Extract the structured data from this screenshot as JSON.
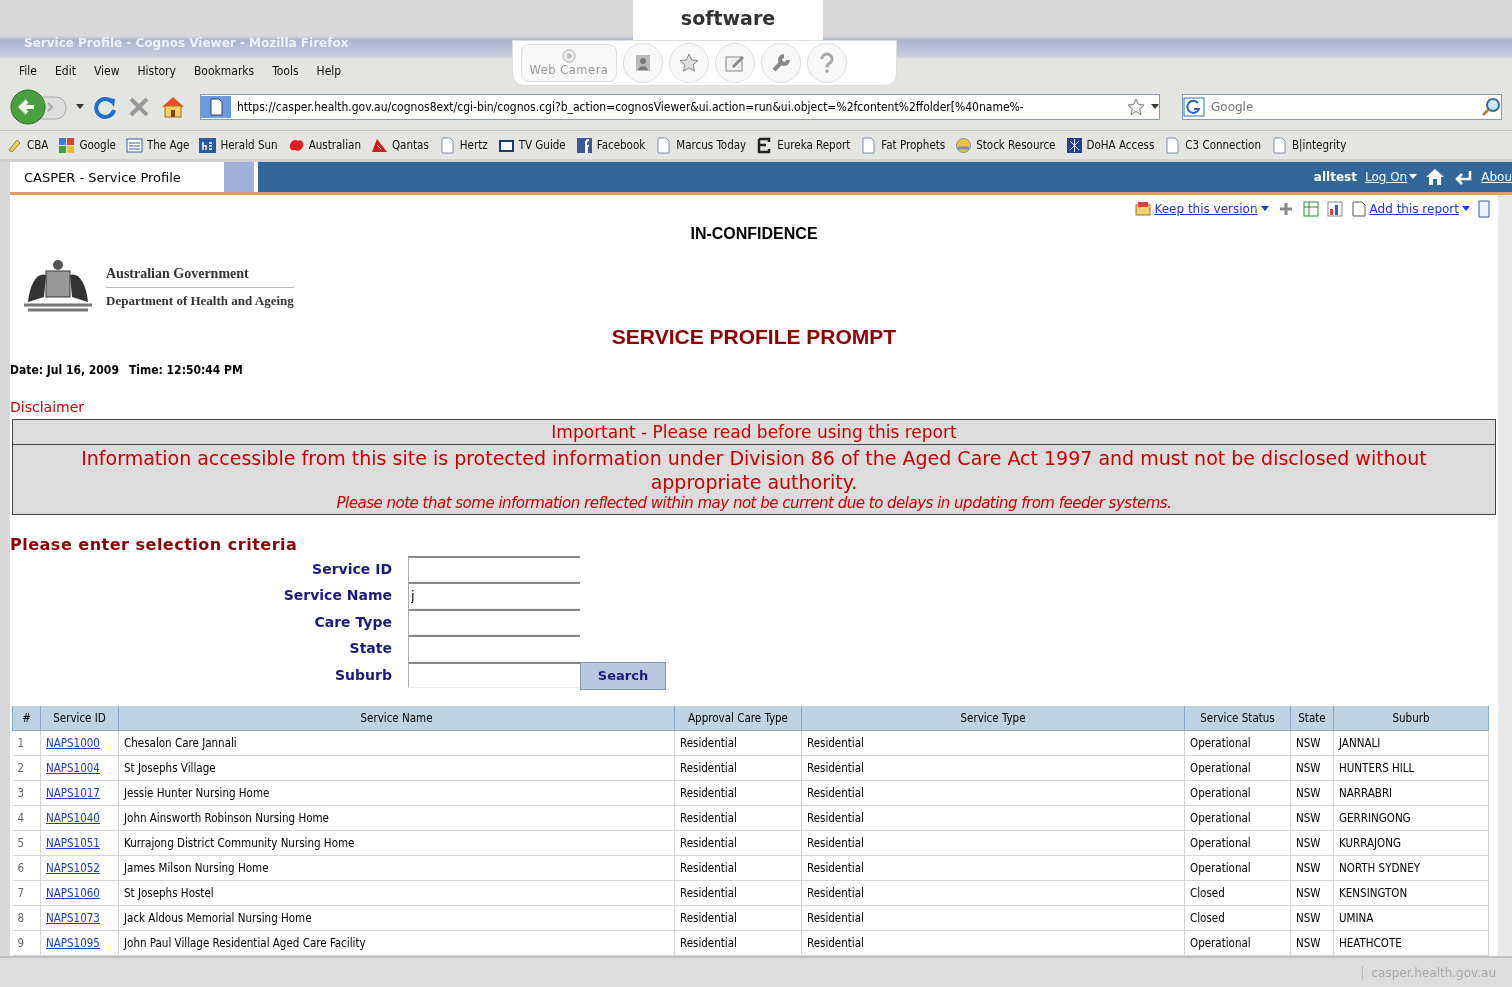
{
  "overlay_logo": {
    "wordmark": "software"
  },
  "webcam_toolbar": {
    "label": "Web Camera"
  },
  "window": {
    "title": "Service Profile - Cognos Viewer - Mozilla Firefox"
  },
  "menu": [
    "File",
    "Edit",
    "View",
    "History",
    "Bookmarks",
    "Tools",
    "Help"
  ],
  "address_bar": {
    "url": "https://casper.health.gov.au/cognos8ext/cgi-bin/cognos.cgi?b_action=cognosViewer&ui.action=run&ui.object=%2fcontent%2ffolder[%40name%-"
  },
  "search": {
    "placeholder": "Google"
  },
  "bookmarks": [
    {
      "label": "CBA",
      "kind": "pencil"
    },
    {
      "label": "Google",
      "kind": "google"
    },
    {
      "label": "The Age",
      "kind": "age"
    },
    {
      "label": "Herald Sun",
      "kind": "hs"
    },
    {
      "label": "Australian",
      "kind": "map"
    },
    {
      "label": "Qantas",
      "kind": "qantas"
    },
    {
      "label": "Hertz",
      "kind": "page"
    },
    {
      "label": "TV Guide",
      "kind": "tv"
    },
    {
      "label": "Facebook",
      "kind": "facebook"
    },
    {
      "label": "Marcus Today",
      "kind": "page"
    },
    {
      "label": "Eureka Report",
      "kind": "letter"
    },
    {
      "label": "Fat Prophets",
      "kind": "page"
    },
    {
      "label": "Stock Resource",
      "kind": "globe"
    },
    {
      "label": "DoHA Access",
      "kind": "network"
    },
    {
      "label": "C3 Connection",
      "kind": "page"
    },
    {
      "label": "B|integrity",
      "kind": "page"
    }
  ],
  "app_bar": {
    "tab": "CASPER  - Service Profile",
    "user": "alltest",
    "log_on": "Log On",
    "about": "Abou"
  },
  "report_toolbar": {
    "keep": "Keep this version",
    "add": "Add this report"
  },
  "report": {
    "classification": "IN-CONFIDENCE",
    "agency": "Australian Government",
    "department": "Department of Health and Ageing",
    "title": "SERVICE PROFILE PROMPT",
    "date_label": "Date:",
    "date": "Jul 16, 2009",
    "time_label": "Time:",
    "time": "12:50:44 PM"
  },
  "disclaimer": {
    "heading": "Disclaimer",
    "banner": "Important - Please read before using this report",
    "notice": "Information accessible from this site is protected information under Division 86 of the Aged Care Act 1997 and must not be disclosed without appropriate authority.",
    "note": "Please note that some information reflected within may not be current due to delays in updating from feeder systems."
  },
  "form": {
    "heading": "Please enter selection criteria",
    "fields": [
      {
        "label": "Service ID"
      },
      {
        "label": "Service Name",
        "value": "j"
      },
      {
        "label": "Care Type"
      },
      {
        "label": "State"
      },
      {
        "label": "Suburb"
      }
    ],
    "search_button": "Search"
  },
  "table": {
    "columns": [
      "#",
      "Service ID",
      "Service Name",
      "Approval Care Type",
      "Service Type",
      "Service Status",
      "State",
      "Suburb"
    ],
    "rows": [
      [
        "1",
        "NAPS1000",
        "Chesalon Care Jannali",
        "Residential",
        "Residential",
        "Operational",
        "NSW",
        "JANNALI"
      ],
      [
        "2",
        "NAPS1004",
        "St Josephs Village",
        "Residential",
        "Residential",
        "Operational",
        "NSW",
        "HUNTERS HILL"
      ],
      [
        "3",
        "NAPS1017",
        "Jessie Hunter Nursing Home",
        "Residential",
        "Residential",
        "Operational",
        "NSW",
        "NARRABRI"
      ],
      [
        "4",
        "NAPS1040",
        "John Ainsworth Robinson Nursing Home",
        "Residential",
        "Residential",
        "Operational",
        "NSW",
        "GERRINGONG"
      ],
      [
        "5",
        "NAPS1051",
        "Kurrajong District Community Nursing Home",
        "Residential",
        "Residential",
        "Operational",
        "NSW",
        "KURRAJONG"
      ],
      [
        "6",
        "NAPS1052",
        "James Milson Nursing Home",
        "Residential",
        "Residential",
        "Operational",
        "NSW",
        "NORTH SYDNEY"
      ],
      [
        "7",
        "NAPS1060",
        "St Josephs Hostel",
        "Residential",
        "Residential",
        "Closed",
        "NSW",
        "KENSINGTON"
      ],
      [
        "8",
        "NAPS1073",
        "Jack Aldous Memorial Nursing Home",
        "Residential",
        "Residential",
        "Closed",
        "NSW",
        "UMINA"
      ],
      [
        "9",
        "NAPS1095",
        "John Paul Village Residential Aged Care Facility",
        "Residential",
        "Residential",
        "Operational",
        "NSW",
        "HEATHCOTE"
      ]
    ]
  },
  "status_bar": {
    "text": "casper.health.gov.au"
  }
}
